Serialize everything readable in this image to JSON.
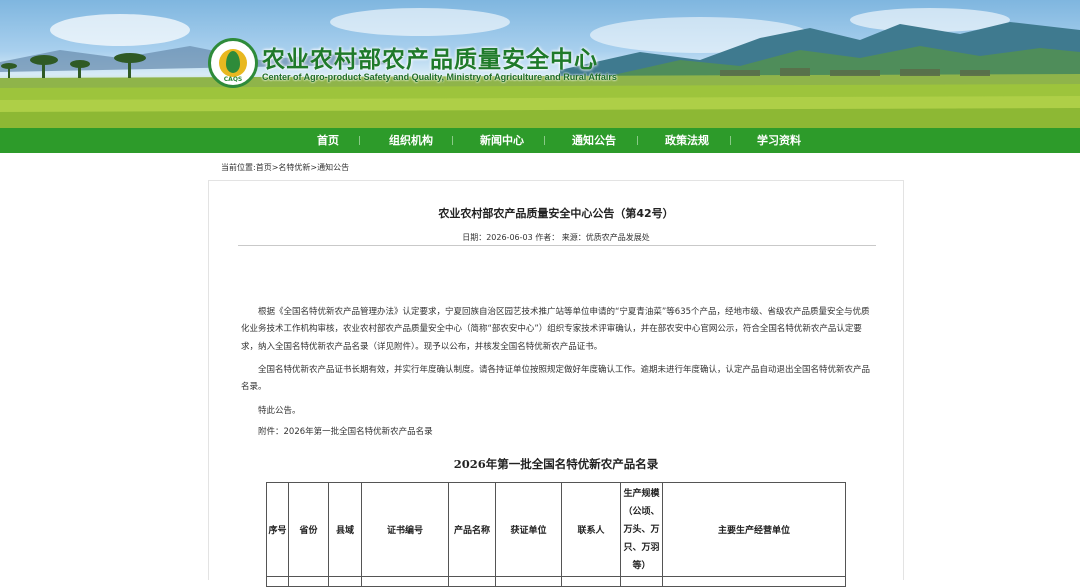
{
  "header": {
    "site_title": "农业农村部农产品质量安全中心",
    "site_subtitle": "Center of Agro-product Safety and Quality, Ministry of Agriculture and Rural Affairs",
    "logo_caption": "CAQS"
  },
  "nav": {
    "items": [
      {
        "label": "首页"
      },
      {
        "label": "组织机构"
      },
      {
        "label": "新闻中心"
      },
      {
        "label": "通知公告"
      },
      {
        "label": "政策法规"
      },
      {
        "label": "学习资料"
      }
    ],
    "separator": "|"
  },
  "breadcrumb": {
    "text": "当前位置:首页>名特优新>通知公告"
  },
  "article": {
    "title": "农业农村部农产品质量安全中心公告（第42号）",
    "meta": "日期：2026-06-03 作者： 来源：优质农产品发展处",
    "paragraphs": [
      "根据《全国名特优新农产品管理办法》认定要求，宁夏回族自治区园艺技术推广站等单位申请的“宁夏青油菜”等635个产品，经地市级、省级农产品质量安全与优质化业务技术工作机构审核，农业农村部农产品质量安全中心（简称“部农安中心”）组织专家技术评审确认，并在部农安中心官网公示，符合全国名特优新农产品认定要求，纳入全国名特优新农产品名录（详见附件）。现予以公布，并核发全国名特优新农产品证书。",
      "全国名特优新农产品证书长期有效，并实行年度确认制度。请各持证单位按照规定做好年度确认工作。逾期未进行年度确认，认定产品自动退出全国名特优新农产品名录。",
      "特此公告。",
      "附件：2026年第一批全国名特优新农产品名录"
    ],
    "list_title": "2026年第一批全国名特优新农产品名录",
    "table_headers": [
      "序号",
      "省份",
      "县域",
      "证书编号",
      "产品名称",
      "获证单位",
      "联系人",
      "生产规模（公顷、万头、万只、万羽等）",
      "主要生产经营单位"
    ]
  },
  "colors": {
    "nav_green": "#2d9b2a",
    "title_green": "#1f7a2a",
    "text": "#333333",
    "border": "#e3e3e3"
  }
}
